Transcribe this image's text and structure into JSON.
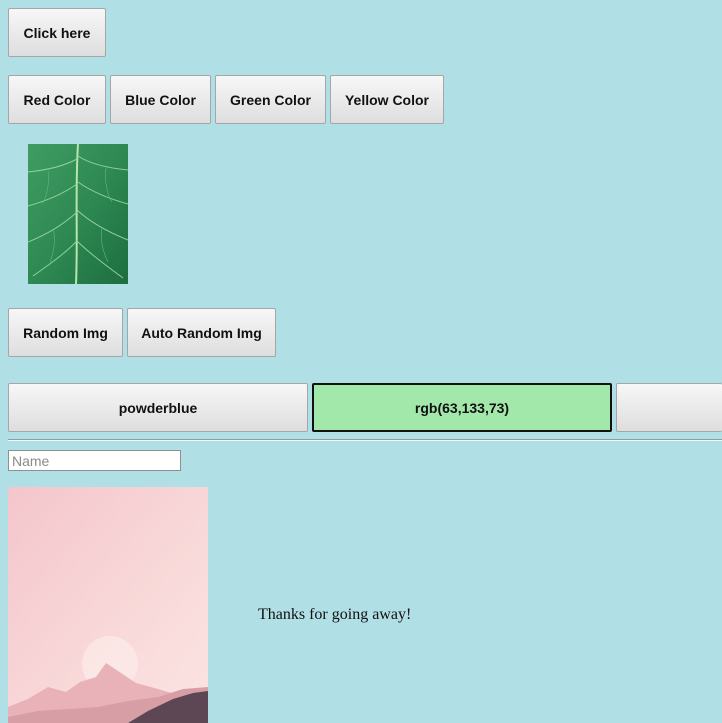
{
  "buttons": {
    "click_here": "Click here",
    "red": "Red Color",
    "blue": "Blue Color",
    "green": "Green Color",
    "yellow": "Yellow Color",
    "random_img": "Random Img",
    "auto_random_img": "Auto Random Img"
  },
  "color_swatches": [
    {
      "label": "powderblue",
      "selected": false
    },
    {
      "label": "rgb(63,133,73)",
      "selected": true,
      "fill": "#a3e8ab"
    },
    {
      "label": "",
      "selected": false
    }
  ],
  "name_field": {
    "placeholder": "Name",
    "value": ""
  },
  "message": "Thanks for going away!",
  "colors": {
    "page_background": "#b0dfe5",
    "selected_swatch": "#a3e8ab"
  },
  "images": {
    "top": "green-leaf",
    "bottom": "pink-sunset-mountains"
  }
}
